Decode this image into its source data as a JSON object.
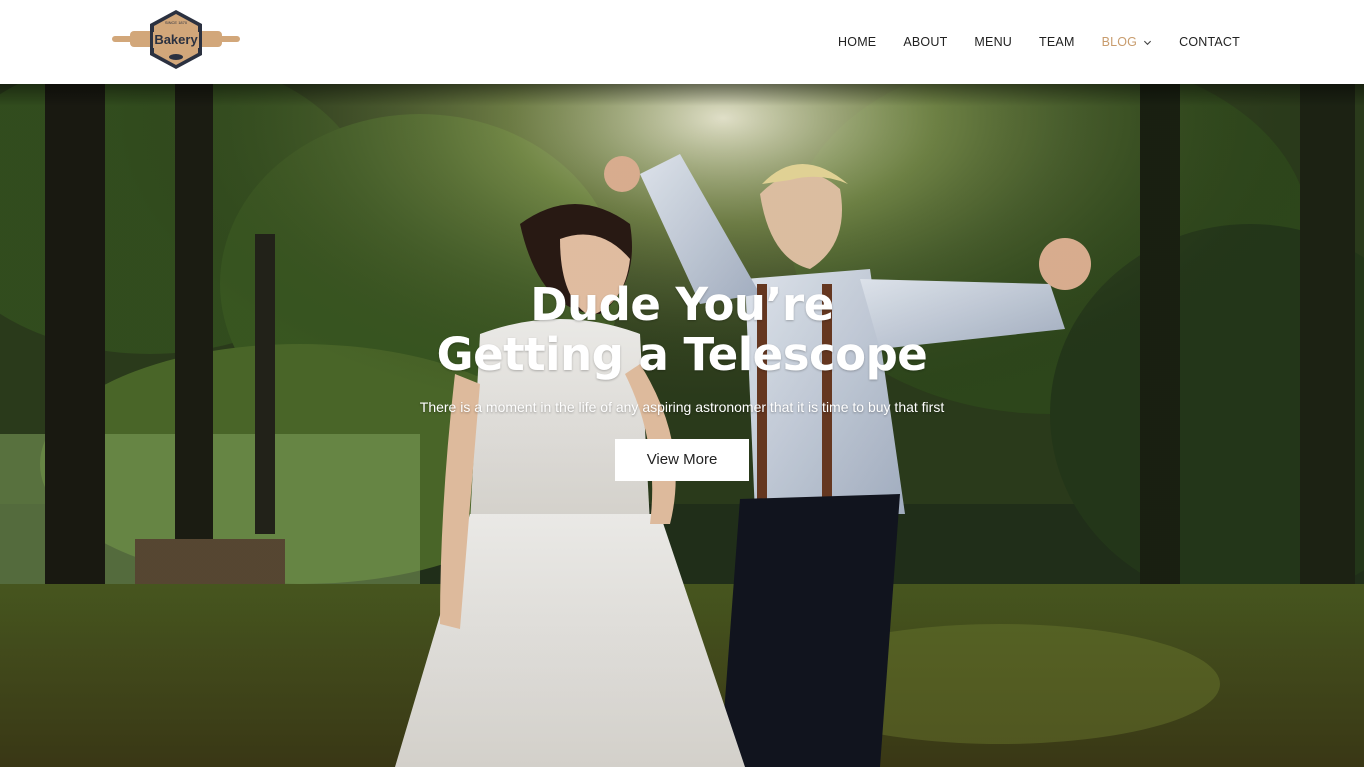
{
  "brand": {
    "logo_text": "Bakery",
    "logo_tagline": "SINCE 1870"
  },
  "nav": {
    "items": [
      {
        "label": "HOME"
      },
      {
        "label": "ABOUT"
      },
      {
        "label": "MENU"
      },
      {
        "label": "TEAM"
      },
      {
        "label": "BLOG",
        "has_dropdown": true,
        "active": true
      },
      {
        "label": "CONTACT"
      }
    ],
    "active_color": "#c89c6d"
  },
  "hero": {
    "title": "Dude You’re Getting a Telescope",
    "subtitle": "There is a moment in the life of any aspiring astronomer that it is time to buy that first",
    "button_label": "View More"
  },
  "colors": {
    "accent": "#c89c6d",
    "logo_dark": "#2b3140",
    "logo_fill": "#d2a77a"
  }
}
